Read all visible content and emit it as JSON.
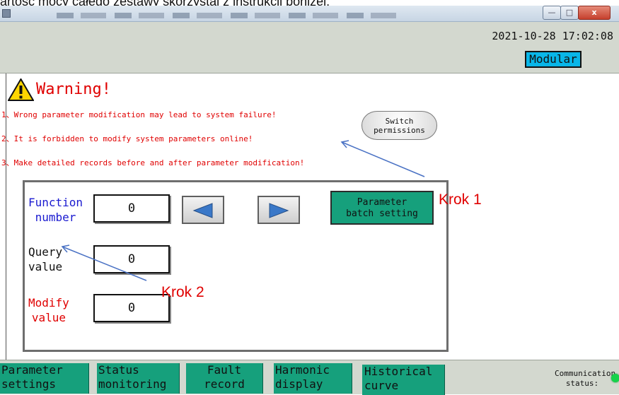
{
  "caption": "artość mocy całego zestawy skorzystaj z instrukcji poniżej:",
  "window": {
    "minimize_label": "—",
    "maximize_label": "□",
    "close_label": "x"
  },
  "header": {
    "datetime": "2021-10-28  17:02:08",
    "mode": "Modular"
  },
  "warning": {
    "title": "Warning!",
    "lines": [
      "1、Wrong parameter modification may lead to system failure!",
      "2、It is forbidden to modify system parameters online!",
      "3、Make detailed records before and after parameter modification!"
    ],
    "switch_button": {
      "line1": "Switch",
      "line2": "permissions"
    }
  },
  "panel": {
    "function_number": {
      "label_line1": "Function",
      "label_line2": "number",
      "value": "0"
    },
    "query_value": {
      "label_line1": "Query",
      "label_line2": "value",
      "value": "0"
    },
    "modify_value": {
      "label_line1": "Modify",
      "label_line2": "value",
      "value": "0"
    },
    "batch_button": {
      "line1": "Parameter",
      "line2": "batch setting"
    }
  },
  "annotations": {
    "step1": "Krok 1",
    "step2": "Krok 2"
  },
  "nav_tabs": [
    {
      "line1": "Parameter",
      "line2": "settings"
    },
    {
      "line1": "Status",
      "line2": "monitoring"
    },
    {
      "line1": "Fault",
      "line2": "record"
    },
    {
      "line1": "Harmonic",
      "line2": "display"
    },
    {
      "line1": "Historical",
      "line2": "curve"
    }
  ],
  "communication": {
    "line1": "Communication",
    "line2": "status:"
  },
  "colors": {
    "accent_green": "#16a07c",
    "warning_red": "#e00000",
    "mode_blue": "#08b6e8",
    "status_green": "#16d24a"
  }
}
